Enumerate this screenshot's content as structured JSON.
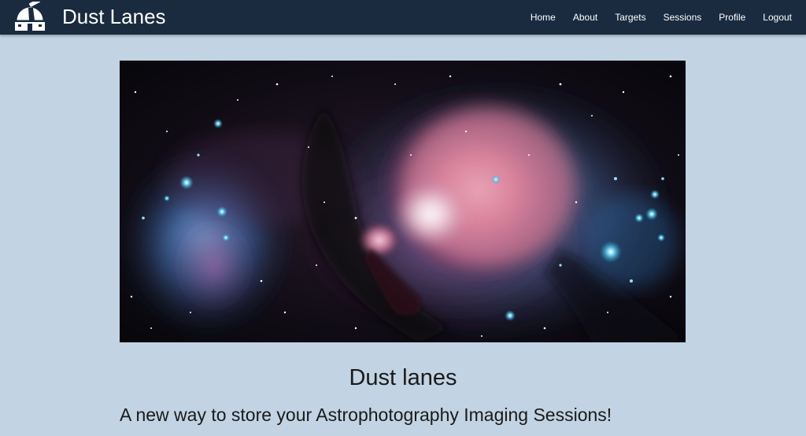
{
  "header": {
    "brand": "Dust Lanes",
    "nav": [
      {
        "label": "Home"
      },
      {
        "label": "About"
      },
      {
        "label": "Targets"
      },
      {
        "label": "Sessions"
      },
      {
        "label": "Profile"
      },
      {
        "label": "Logout"
      }
    ],
    "logo_icon": "observatory-dome-icon"
  },
  "hero": {
    "subject": "orion-nebula-image"
  },
  "main": {
    "heading": "Dust lanes",
    "tagline": "A new way to store your Astrophotography Imaging Sessions!"
  },
  "colors": {
    "navbar": "#1a2b40",
    "background": "#c2d3e3",
    "text": "#1a1a1a"
  }
}
